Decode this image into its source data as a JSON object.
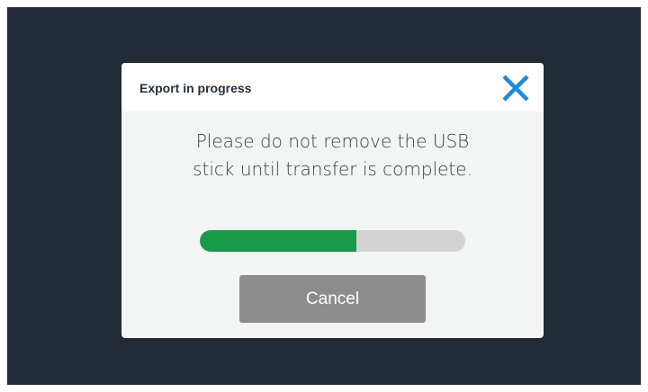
{
  "dialog": {
    "title": "Export in progress",
    "message": "Please do not remove the USB stick until transfer is complete.",
    "progress": 0.59,
    "cancel_label": "Cancel",
    "close_icon": "close-icon"
  },
  "colors": {
    "screen_background": "#232c36",
    "dialog_background": "#f3f4f4",
    "header_background": "#ffffff",
    "close_icon": "#1f8ad8",
    "progress_fill": "#189b4a",
    "progress_track": "#d3d3d3",
    "cancel_button": "#8c8c8c"
  }
}
